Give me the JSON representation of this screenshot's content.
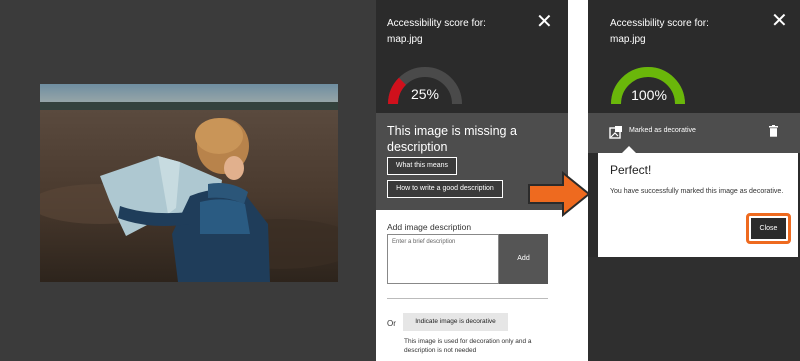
{
  "left_panel": {
    "title_line1": "Accessibility score for:",
    "title_line2": "map.jpg",
    "score": "25%",
    "score_fraction": 0.25,
    "gauge_color": "#d0101c",
    "missing_title": "This image is missing a description",
    "what_means_label": "What this means",
    "how_to_write_label": "How to write a good description",
    "add_desc_label": "Add image description",
    "desc_placeholder": "Enter a brief description",
    "add_button_label": "Add",
    "or_label": "Or",
    "decorative_button_label": "Indicate image is decorative",
    "decorative_note": "This image is used for decoration only and a description is not needed",
    "close_symbol": "✕"
  },
  "right_panel": {
    "title_line1": "Accessibility score for:",
    "title_line2": "map.jpg",
    "score": "100%",
    "score_fraction": 1.0,
    "gauge_color": "#6ab70a",
    "marked_decorative_label": "Marked as decorative",
    "success_title": "Perfect!",
    "success_message": "You have successfully marked this image as decorative.",
    "close_button_label": "Close",
    "close_symbol": "✕"
  },
  "colors": {
    "dark_bg": "#2b2b2b",
    "gray_bg": "#4d4d4d",
    "accent_orange": "#ee6a1f"
  }
}
